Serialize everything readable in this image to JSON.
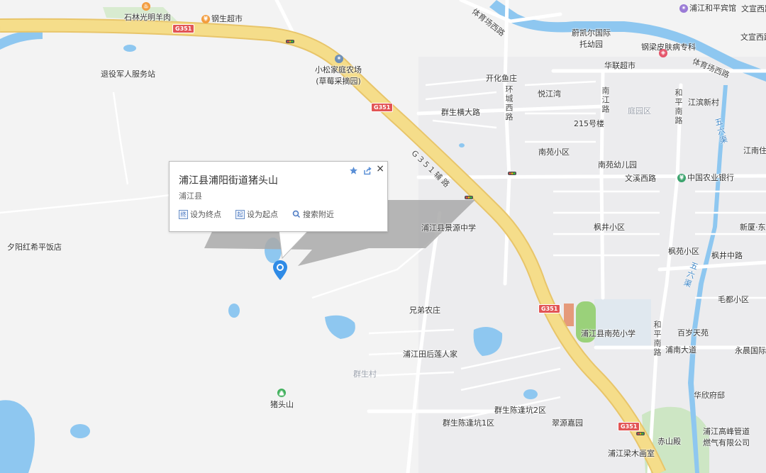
{
  "popup": {
    "title": "浦江县浦阳街道猪头山",
    "subtitle": "浦江县",
    "actions": {
      "set_end": "设为终点",
      "set_start": "设为起点",
      "search_nearby": "搜索附近"
    },
    "end_icon": "终",
    "start_icon": "起",
    "close": "×"
  },
  "shields": {
    "s1": "G351",
    "s2": "G351",
    "s3": "G351",
    "s4": "G351"
  },
  "roads": {
    "g351_aux": "G 3 5 1 辅 路",
    "tiyuchang_w1": "体育场西路",
    "tiyuchang_w2": "体育场西路",
    "huancheng_w": "环城西路",
    "nanjiang": "南江路",
    "heping_s1": "和平南路",
    "heping_s2": "和平南路",
    "wenxi_w": "文溪西路",
    "fengjing_zh": "枫井中路",
    "punan": "浦南大道",
    "wenxuan_w": "文宣西路"
  },
  "water": {
    "wuliu1": "五六渠",
    "wuliu2": "五六渠"
  },
  "areas": {
    "tingyuan": "庭园区",
    "qunsheng": "群生村"
  },
  "pois": {
    "shilin": "石林光明羊肉",
    "gangsheng": "钢生超市",
    "tuiyi": "退役军人服务站",
    "xiaosong1": "小松家庭农场",
    "xiaosong2": "(草莓采摘园)",
    "weikaier1": "蔚凯尔国际",
    "weikaier2": "托幼园",
    "gangliang": "钢梁皮肤病专科",
    "hualian": "华联超市",
    "pujiang_heping": "浦江和平宾馆",
    "wenxuan": "文宣西路",
    "kaihua": "开化鱼庄",
    "yuejiang": "悦江湾",
    "jiangbin": "江滨新村",
    "qunsheng_heng": "群生横大路",
    "no215": "215号楼",
    "nanyuan_xq": "南苑小区",
    "nanyuan_yey": "南苑幼儿园",
    "jiangnan": "江南住",
    "nongye": "中国农业银行",
    "fengjing_xq": "枫井小区",
    "xinxia": "新厦·东",
    "jingyuan": "浦江县景源中学",
    "yangyang": "夕阳红希平饭店",
    "fengyuan": "枫苑小区",
    "maodu": "毛都小区",
    "xiongdi": "兄弟农庄",
    "nanyuan_xx": "浦江县南苑小学",
    "baisui": "百岁天苑",
    "yongchen": "永晨国际",
    "tianhou": "浦江田后莲人家",
    "zhutoushan": "猪头山",
    "huaxin": "华欣府邸",
    "chenpeng2": "群生陈逢坑2区",
    "chenpeng1": "群生陈逢坑1区",
    "cuiyuan": "翠源嘉园",
    "chishan": "赤山殿",
    "gaofeng1": "浦江高峰管道",
    "gaofeng2": "燃气有限公司",
    "liangmu": "浦江梁木画室"
  },
  "colors": {
    "expressway": "#f5dd8a",
    "expressway_edge": "#e8c56a",
    "water": "#8ec7f0",
    "school": "#e0e8ef",
    "park": "#cde6c4",
    "pin": "#2f8be6",
    "shield": "#e25555"
  },
  "icons": [
    "location-pin-icon",
    "star-icon",
    "share-icon",
    "close-icon",
    "search-icon",
    "food-icon",
    "shop-icon",
    "hospital-icon",
    "school-icon",
    "bank-icon",
    "mountain-icon",
    "traffic-light-icon"
  ]
}
